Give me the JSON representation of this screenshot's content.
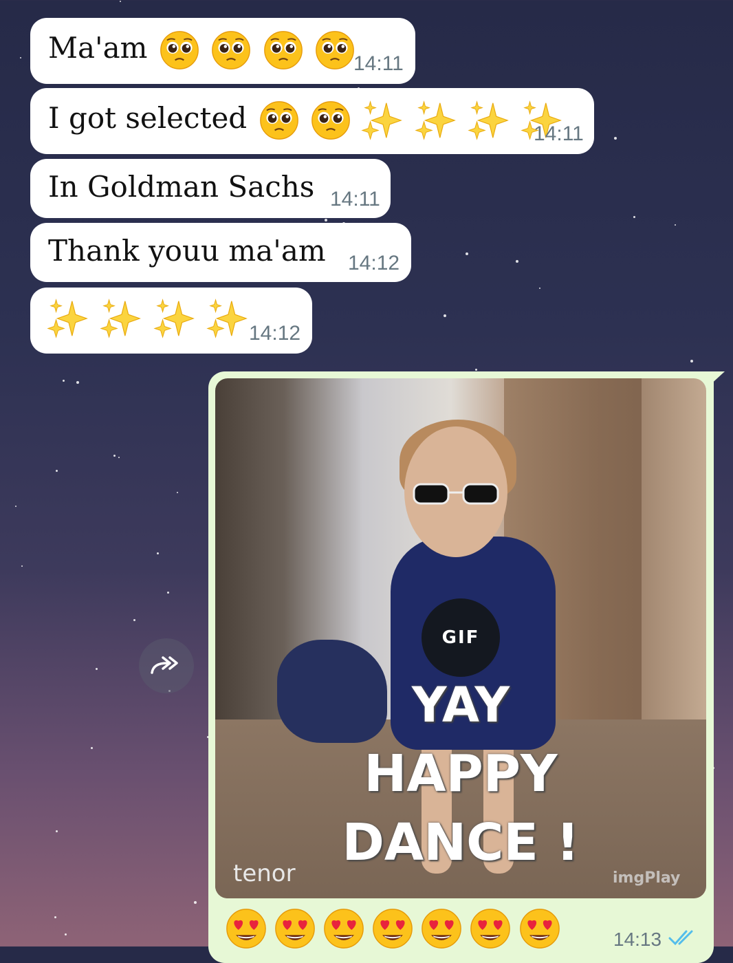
{
  "messages": [
    {
      "text": "Ma'am",
      "time": "14:11",
      "emojis": [
        "pleading-face",
        "pleading-face",
        "pleading-face",
        "pleading-face"
      ]
    },
    {
      "text": "I got selected",
      "time": "14:11",
      "emojis": [
        "pleading-face",
        "pleading-face",
        "sparkles",
        "sparkles",
        "sparkles",
        "sparkles"
      ]
    },
    {
      "text": "In Goldman Sachs",
      "time": "14:11"
    },
    {
      "text": "Thank youu ma'am",
      "time": "14:12"
    },
    {
      "text": "",
      "time": "14:12",
      "emojis": [
        "sparkles",
        "sparkles",
        "sparkles",
        "sparkles"
      ]
    }
  ],
  "outgoing": {
    "gif_badge": "GIF",
    "caption_line1": "YAY",
    "caption_line2": "HAPPY",
    "caption_line3": "DANCE !",
    "watermark_left": "tenor",
    "watermark_right": "imgPlay",
    "emojis": [
      "heart-eyes-face",
      "heart-eyes-face",
      "heart-eyes-face",
      "heart-eyes-face",
      "heart-eyes-face",
      "heart-eyes-face",
      "heart-eyes-face"
    ],
    "time": "14:13",
    "status_icon": "double-check-read-icon"
  },
  "colors": {
    "incoming_bubble": "#ffffff",
    "outgoing_bubble": "#e7f8d6",
    "timestamp": "#667781",
    "read_ticks": "#53bdeb"
  }
}
